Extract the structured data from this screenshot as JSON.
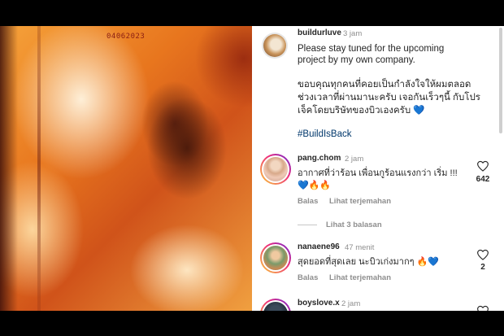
{
  "photo": {
    "date_stamp": "04062023"
  },
  "post": {
    "author": "buildurluve",
    "time": "3 jam",
    "caption_lines": [
      "Please stay tuned for the upcoming",
      "project by my own company."
    ],
    "caption_thai_lines": [
      "ขอบคุณทุกคนที่คอยเป็นกำลังใจให้ผมตลอด",
      "ช่วงเวลาที่ผ่านมานะครับ  เจอกันเร็วๆนี้ กับโปร",
      "เจ็คโดยบริษัทของบิวเองครับ"
    ],
    "caption_emoji": "💙",
    "hashtag": "#BuildIsBack"
  },
  "comments": [
    {
      "username": "pang.chom",
      "time": "2 jam",
      "text_lines": [
        "อากาศที่ว่าร้อน เพื่อนกูร้อนแรงกว่า เริ่ม !!!",
        "💙🔥🔥"
      ],
      "likes": "642",
      "reply_label": "Balas",
      "translate_label": "Lihat terjemahan",
      "view_replies": "Lihat 3 balasan"
    },
    {
      "username": "nanaene96",
      "time": "47 menit",
      "text_lines": [
        "สุดยอดที่สุดเลย นะบิวเก่งมากๆ 🔥💙"
      ],
      "likes": "2",
      "reply_label": "Balas",
      "translate_label": "Lihat terjemahan"
    },
    {
      "username": "boyslove.x",
      "time": "2 jam"
    }
  ],
  "icons": [
    "heart-outline-icon"
  ]
}
